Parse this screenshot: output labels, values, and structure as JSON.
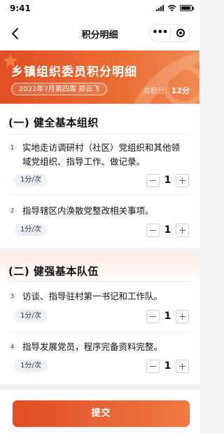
{
  "status_bar": {
    "time": "9:41",
    "icons": [
      "signal-icon",
      "wifi-icon",
      "battery-icon"
    ]
  },
  "nav": {
    "title": "积分明细",
    "back_icon": "chevron-left-icon",
    "more_label": "•••",
    "more_icon": "more-dots-icon",
    "target_icon": "target-icon"
  },
  "banner": {
    "title": "乡镇组织委员积分明细",
    "week_label": "2022年7月第四周 郑云飞",
    "total_label": "总积分：",
    "total_value": "12分"
  },
  "sections": [
    {
      "title": "(一) 健全基本组织",
      "items": [
        {
          "num": "1",
          "text": "实地走访调研村（社区）党组织和其他领域党组织、指导工作、做记录。",
          "tag": "1分/次",
          "value": "1"
        },
        {
          "num": "2",
          "text": "指导辖区内涣散党整改相关事项。",
          "tag": "1分/次",
          "value": "1"
        }
      ]
    },
    {
      "title": "(二) 健强基本队伍",
      "items": [
        {
          "num": "3",
          "text": "访谈、指导驻村第一书记和工作队。",
          "tag": "1分/次",
          "value": "1"
        },
        {
          "num": "4",
          "text": "指导发展党员，程序完备资料完整。",
          "tag": "1分/次",
          "value": "1"
        }
      ]
    }
  ],
  "submit_label": "提交",
  "colors": {
    "accent": "#e55a2b",
    "accent_light": "#f08a4e",
    "tag_bg": "#eef1f8",
    "page_bg": "#f4f4f6"
  }
}
